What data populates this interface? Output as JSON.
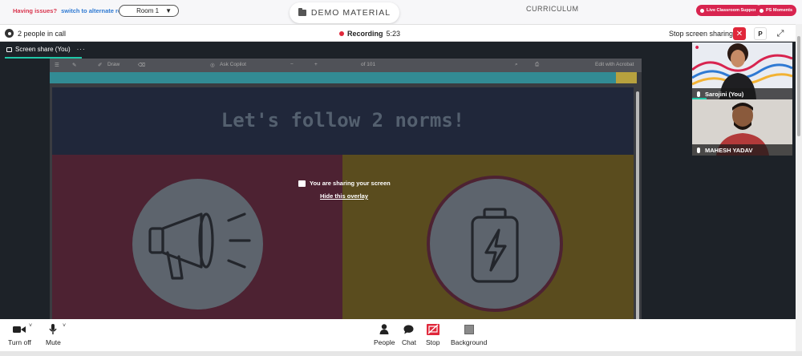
{
  "topbar": {
    "issues_text": "Having issues?",
    "alt_room_link": "switch to alternate room",
    "room_select": "Room 1",
    "demo_material": "DEMO MATERIAL",
    "curriculum": "CURRICULUM",
    "live_support": "Live Classroom Support",
    "ps_moments": "PS Moments"
  },
  "callbar": {
    "people_count": "2 people in call",
    "recording_label": "Recording",
    "recording_time": "5:23",
    "stop_sharing": "Stop screen sharing",
    "p_button": "P"
  },
  "stage": {
    "share_tab_label": "Screen share (You)",
    "share_tab_menu": "···",
    "pdf_toolbar": {
      "draw": "Draw",
      "ask_copilot": "Ask Copilot",
      "page": "of 101",
      "edit_acrobat": "Edit with Acrobat"
    },
    "slide_title": "Let's follow 2 norms!",
    "overlay_message": "You are sharing your screen",
    "overlay_link": "Hide this overlay"
  },
  "participants": [
    {
      "name": "Sarojini (You)"
    },
    {
      "name": "MAHESH YADAV"
    }
  ],
  "toolbar": {
    "turn_off": "Turn off",
    "mute": "Mute",
    "people": "People",
    "chat": "Chat",
    "stop": "Stop",
    "background": "Background"
  },
  "colors": {
    "accent_teal": "#1fc7a7",
    "record_red": "#e0273a",
    "brand_pink": "#d8244f"
  }
}
